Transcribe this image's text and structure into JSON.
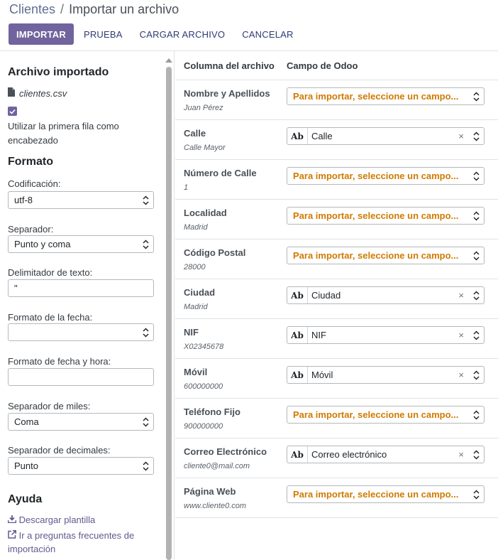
{
  "breadcrumb": {
    "root": "Clientes",
    "separator": "/",
    "current": "Importar un archivo"
  },
  "toolbar": {
    "import_label": "IMPORTAR",
    "test_label": "PRUEBA",
    "upload_label": "CARGAR ARCHIVO",
    "cancel_label": "CANCELAR"
  },
  "sidebar": {
    "imported_title": "Archivo importado",
    "file_name": "clientes.csv",
    "header_checkbox_label": "Utilizar la primera fila como encabezado",
    "format_title": "Formato",
    "encoding_label": "Codificación:",
    "encoding_value": "utf-8",
    "separator_label": "Separador:",
    "separator_value": "Punto y coma",
    "text_delim_label": "Delimitador de texto:",
    "text_delim_value": "\"",
    "date_format_label": "Formato de la fecha:",
    "date_format_value": "",
    "datetime_format_label": "Formato de fecha y hora:",
    "datetime_format_value": "",
    "thousands_label": "Separador de miles:",
    "thousands_value": "Coma",
    "decimal_label": "Separador de decimales:",
    "decimal_value": "Punto",
    "help_title": "Ayuda",
    "download_template": "Descargar plantilla",
    "faq_link": "Ir a preguntas frecuentes de importación"
  },
  "table": {
    "col_file": "Columna del archivo",
    "col_odoo": "Campo de Odoo",
    "placeholder": "Para importar, seleccione un campo...",
    "type_badge": "Ab",
    "clear_symbol": "×",
    "rows": [
      {
        "name": "Nombre y Apellidos",
        "sample": "Juan Pérez",
        "field": ""
      },
      {
        "name": "Calle",
        "sample": "Calle Mayor",
        "field": "Calle"
      },
      {
        "name": "Número de Calle",
        "sample": "1",
        "field": ""
      },
      {
        "name": "Localidad",
        "sample": "Madrid",
        "field": ""
      },
      {
        "name": "Código Postal",
        "sample": "28000",
        "field": ""
      },
      {
        "name": "Ciudad",
        "sample": "Madrid",
        "field": "Ciudad"
      },
      {
        "name": "NIF",
        "sample": "X02345678",
        "field": "NIF"
      },
      {
        "name": "Móvil",
        "sample": "600000000",
        "field": "Móvil"
      },
      {
        "name": "Teléfono Fijo",
        "sample": "900000000",
        "field": ""
      },
      {
        "name": "Correo Electrónico",
        "sample": "cliente0@mail.com",
        "field": "Correo electrónico"
      },
      {
        "name": "Página Web",
        "sample": "www.cliente0.com",
        "field": ""
      }
    ]
  },
  "colors": {
    "primary": "#71639e",
    "placeholder": "#d07a00"
  }
}
